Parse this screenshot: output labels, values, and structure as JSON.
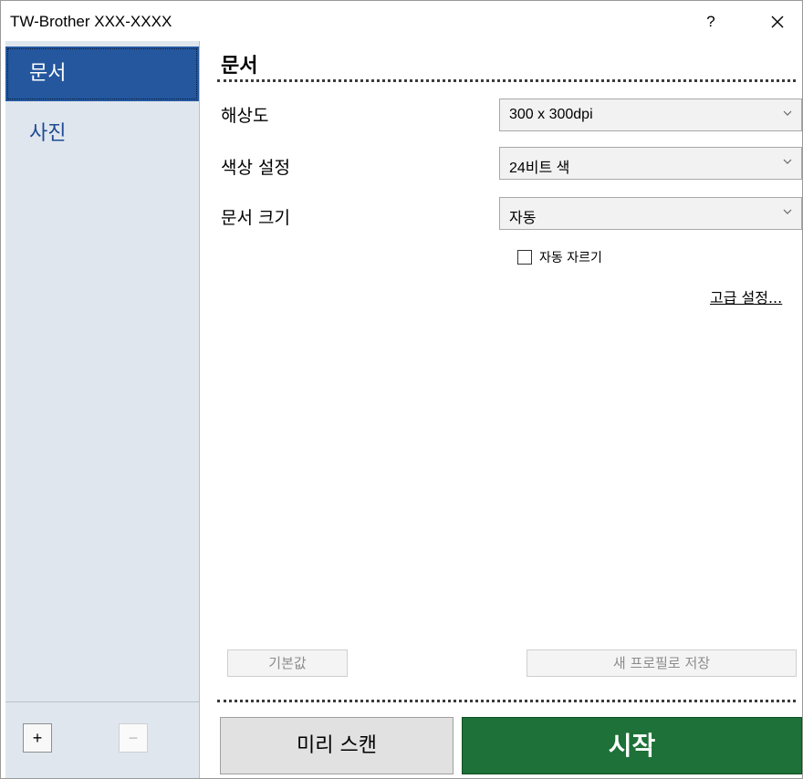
{
  "window": {
    "title": "TW-Brother XXX-XXXX",
    "help_label": "?",
    "close_icon": "close-icon"
  },
  "sidebar": {
    "items": [
      {
        "label": "문서",
        "active": true
      },
      {
        "label": "사진",
        "active": false
      }
    ],
    "add_label": "+",
    "remove_label": "−"
  },
  "main": {
    "section_title": "문서",
    "settings": [
      {
        "label": "해상도",
        "value": "300 x 300dpi"
      },
      {
        "label": "색상 설정",
        "value": "24비트 색"
      },
      {
        "label": "문서 크기",
        "value": "자동"
      }
    ],
    "auto_crop": {
      "label": "자동 자르기",
      "checked": false
    },
    "advanced_link": "고급 설정...",
    "default_button": "기본값",
    "save_profile_button": "새 프로필로 저장",
    "prescan_button": "미리 스캔",
    "start_button": "시작"
  },
  "colors": {
    "sidebar_bg": "#dfe6ee",
    "sidebar_active": "#24579e",
    "start_green": "#1e7138"
  }
}
